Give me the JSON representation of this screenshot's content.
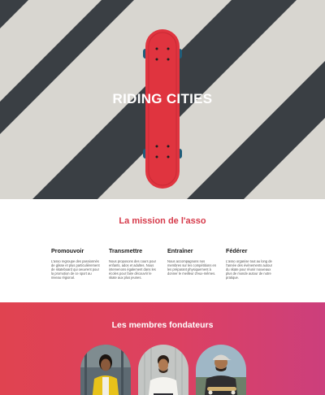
{
  "hero": {
    "title": "RIDING CITIES",
    "image": "skateboard-on-crosswalk"
  },
  "mission": {
    "title": "La mission de l'asso",
    "features": [
      {
        "title": "Promouvoir",
        "text": "L'asso regroupe des passionnés de glisse et plus particulièrement de skateboard qui oeuvrent pour la promotion de ce sport au niveau régional."
      },
      {
        "title": "Transmettre",
        "text": "Nous proposons des cours pour enfants, ados et adultes. Nous intervenons également dans les écoles pour faire découvrir le skate aux plus jeunes."
      },
      {
        "title": "Entraîner",
        "text": "Nous accompagnons nos membres sur les compétitions en les préparant physiquement à donner le meilleur d'eux-mêmes."
      },
      {
        "title": "Fédérer",
        "text": "L'asso organise tout au long de l'année des événements autour du skate pour réunir nouveaux plus de monde autour de notre pratique."
      }
    ]
  },
  "founders": {
    "title": "Les membres fondateurs",
    "members": [
      {
        "photo": "woman-yellow-jacket"
      },
      {
        "photo": "man-white-tshirt"
      },
      {
        "photo": "man-cap-skateboard"
      }
    ]
  },
  "colors": {
    "accent": "#d63a4a",
    "gradient_start": "#e04350",
    "gradient_end": "#cc3f7c",
    "skateboard": "#e0343f"
  }
}
